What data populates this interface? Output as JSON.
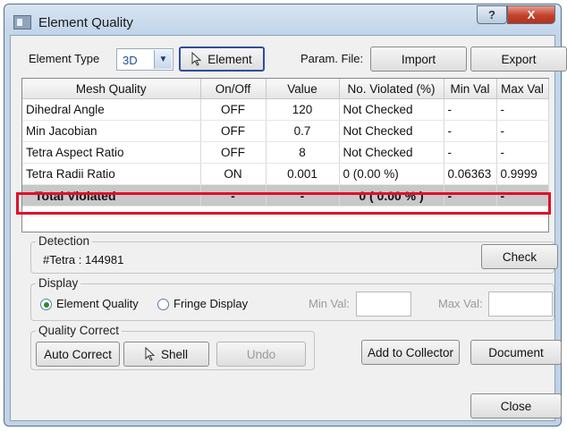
{
  "window": {
    "title": "Element Quality",
    "help_label": "?",
    "close_glyph": "X"
  },
  "toolbar": {
    "element_type_label": "Element Type",
    "element_type_value": "3D",
    "element_button_label": "Element",
    "param_file_label": "Param. File:",
    "import_label": "Import",
    "export_label": "Export"
  },
  "table": {
    "columns": [
      "Mesh Quality",
      "On/Off",
      "Value",
      "No. Violated (%)",
      "Min Val",
      "Max Val"
    ],
    "rows": [
      {
        "name": "Dihedral Angle",
        "onoff": "OFF",
        "value": "120",
        "violated": "Not Checked",
        "min": "-",
        "max": "-"
      },
      {
        "name": "Min Jacobian",
        "onoff": "OFF",
        "value": "0.7",
        "violated": "Not Checked",
        "min": "-",
        "max": "-"
      },
      {
        "name": "Tetra Aspect Ratio",
        "onoff": "OFF",
        "value": "8",
        "violated": "Not Checked",
        "min": "-",
        "max": "-"
      },
      {
        "name": "Tetra Radii Ratio",
        "onoff": "ON",
        "value": "0.001",
        "violated": "0 (0.00 %)",
        "min": "0.06363",
        "max": "0.9999"
      }
    ],
    "total": {
      "name": "Total Violated",
      "onoff": "-",
      "value": "-",
      "violated": "0 ( 0.00 % )",
      "min": "-",
      "max": "-"
    },
    "highlight_color": "#e0102a"
  },
  "detection": {
    "label": "Detection",
    "tetra_count": "#Tetra : 144981",
    "check_label": "Check"
  },
  "display": {
    "label": "Display",
    "option1": "Element Quality",
    "option2": "Fringe Display",
    "selected": "Element Quality",
    "min_label": "Min Val:",
    "max_label": "Max Val:",
    "min_value": "",
    "max_value": ""
  },
  "quality_correct": {
    "label": "Quality Correct",
    "auto_correct_label": "Auto Correct",
    "shell_label": "Shell",
    "undo_label": "Undo"
  },
  "actions": {
    "add_to_collector_label": "Add to Collector",
    "document_label": "Document",
    "close_label": "Close"
  },
  "icons": [
    "window-icon",
    "help-icon",
    "close-icon",
    "chevron-down-icon",
    "cursor-arrow-icon"
  ]
}
